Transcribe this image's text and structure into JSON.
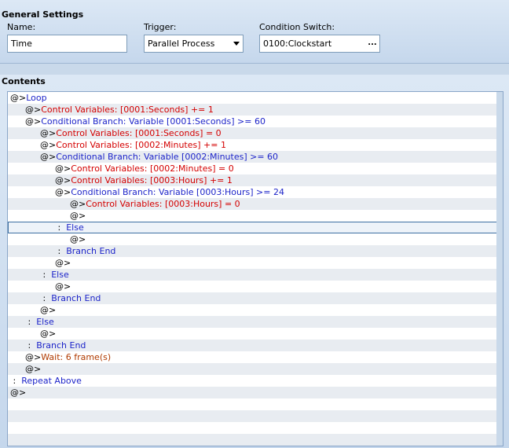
{
  "general": {
    "title": "General Settings",
    "name_label": "Name:",
    "name_value": "Time",
    "trigger_label": "Trigger:",
    "trigger_value": "Parallel Process",
    "switch_label": "Condition Switch:",
    "switch_value": "0100:Clockstart",
    "switch_button": "..."
  },
  "contents": {
    "title": "Contents",
    "rows": [
      {
        "indent": 0,
        "prefix": "@>",
        "text": "Loop",
        "kind": "flow"
      },
      {
        "indent": 1,
        "prefix": "@>",
        "text": "Control Variables: [0001:Seconds] += 1",
        "kind": "var"
      },
      {
        "indent": 1,
        "prefix": "@>",
        "text": "Conditional Branch: Variable [0001:Seconds] >= 60",
        "kind": "flow"
      },
      {
        "indent": 2,
        "prefix": "@>",
        "text": "Control Variables: [0001:Seconds] = 0",
        "kind": "var"
      },
      {
        "indent": 2,
        "prefix": "@>",
        "text": "Control Variables: [0002:Minutes] += 1",
        "kind": "var"
      },
      {
        "indent": 2,
        "prefix": "@>",
        "text": "Conditional Branch: Variable [0002:Minutes] >= 60",
        "kind": "flow"
      },
      {
        "indent": 3,
        "prefix": "@>",
        "text": "Control Variables: [0002:Minutes] = 0",
        "kind": "var"
      },
      {
        "indent": 3,
        "prefix": "@>",
        "text": "Control Variables: [0003:Hours] += 1",
        "kind": "var"
      },
      {
        "indent": 3,
        "prefix": "@>",
        "text": "Conditional Branch: Variable [0003:Hours] >= 24",
        "kind": "flow"
      },
      {
        "indent": 4,
        "prefix": "@>",
        "text": "Control Variables: [0003:Hours] = 0",
        "kind": "var"
      },
      {
        "indent": 4,
        "prefix": "@>",
        "text": "",
        "kind": "none"
      },
      {
        "indent": 3,
        "prefix": " :  ",
        "text": "Else",
        "kind": "flow",
        "selected": true
      },
      {
        "indent": 4,
        "prefix": "@>",
        "text": "",
        "kind": "none"
      },
      {
        "indent": 3,
        "prefix": " :  ",
        "text": "Branch End",
        "kind": "flow"
      },
      {
        "indent": 3,
        "prefix": "@>",
        "text": "",
        "kind": "none"
      },
      {
        "indent": 2,
        "prefix": " :  ",
        "text": "Else",
        "kind": "flow"
      },
      {
        "indent": 3,
        "prefix": "@>",
        "text": "",
        "kind": "none"
      },
      {
        "indent": 2,
        "prefix": " :  ",
        "text": "Branch End",
        "kind": "flow"
      },
      {
        "indent": 2,
        "prefix": "@>",
        "text": "",
        "kind": "none"
      },
      {
        "indent": 1,
        "prefix": " :  ",
        "text": "Else",
        "kind": "flow"
      },
      {
        "indent": 2,
        "prefix": "@>",
        "text": "",
        "kind": "none"
      },
      {
        "indent": 1,
        "prefix": " :  ",
        "text": "Branch End",
        "kind": "flow"
      },
      {
        "indent": 1,
        "prefix": "@>",
        "text": "Wait: 6 frame(s)",
        "kind": "wait"
      },
      {
        "indent": 1,
        "prefix": "@>",
        "text": "",
        "kind": "none"
      },
      {
        "indent": 0,
        "prefix": " :  ",
        "text": "Repeat Above",
        "kind": "flow"
      },
      {
        "indent": 0,
        "prefix": "@>",
        "text": "",
        "kind": "none"
      }
    ],
    "empty_rows": 4
  },
  "colors": {
    "flow": "#1d24c9",
    "var": "#d40000",
    "wait": "#b03a00"
  }
}
